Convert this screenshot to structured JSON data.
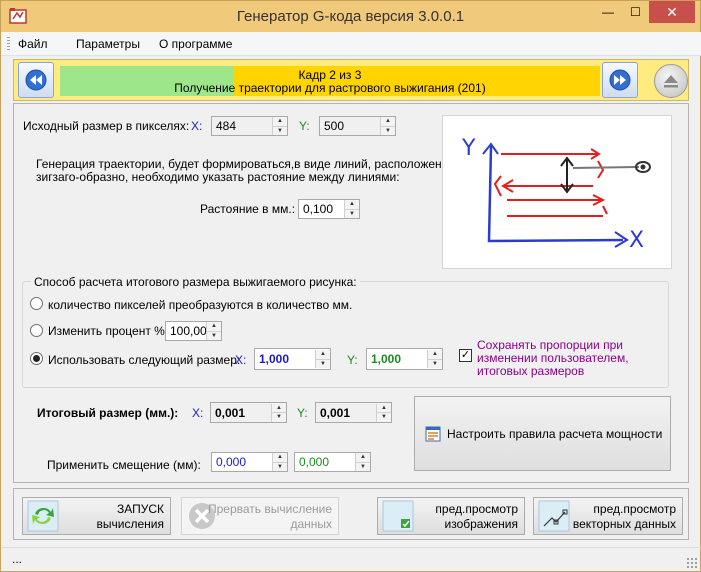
{
  "window": {
    "title": "Генератор G-кода версия 3.0.0.1",
    "min_symbol": "—",
    "max_symbol": "☐",
    "close_symbol": "✕"
  },
  "menu": {
    "items": [
      {
        "label": "Файл"
      },
      {
        "label": "Параметры"
      },
      {
        "label": "О программе"
      }
    ]
  },
  "wizard": {
    "step_text": "Кадр 2 из 3",
    "step_desc": "Получение траектории для растрового выжигания (201)",
    "progress_fraction": 0.32
  },
  "source_size": {
    "label": "Исходный размер в пикселях:",
    "x_label": "X:",
    "x_value": "484",
    "y_label": "Y:",
    "y_value": "500"
  },
  "description": {
    "line1": "Генерация траектории, будет формироваться,в виде линий, расположенных",
    "line2": "зигзаго-образно,  необходимо указать растояние между линиями:"
  },
  "distance": {
    "label": "Растояние в мм.:",
    "value": "0,100"
  },
  "preview": {
    "y_axis_label": "Y",
    "x_axis_label": "X"
  },
  "calc_group": {
    "title": "Способ расчета итогового размера выжигаемого рисунка:",
    "option_pixels": "количество пикселей преобразуются в количество мм.",
    "option_percent": "Изменить процент %",
    "percent_value": "100,00",
    "option_size": "Использовать следующий размер:",
    "x_label": "X:",
    "x_value": "1,000",
    "y_label": "Y:",
    "y_value": "1,000",
    "selected": "option_size",
    "keep_proportions_line1": "Сохранять пропорции при",
    "keep_proportions_line2": "изменении пользователем,",
    "keep_proportions_line3": "итоговых размеров",
    "keep_proportions_checked": true,
    "checkmark": "✓",
    "accent_color": "#8b008b"
  },
  "final_size": {
    "label": "Итоговый размер (мм.):",
    "x_label": "X:",
    "x_value": "0,001",
    "y_label": "Y:",
    "y_value": "0,001"
  },
  "offset": {
    "label": "Применить смещение (мм):",
    "x_value": "0,000",
    "y_value": "0,000"
  },
  "power_button": {
    "label": "Настроить правила расчета мощности"
  },
  "bottom_buttons": {
    "start_line1": "ЗАПУСК",
    "start_line2": "вычисления",
    "abort_line1": "Прервать вычисление",
    "abort_line2": "данных",
    "preview_image_line1": "пред.просмотр",
    "preview_image_line2": "изображения",
    "preview_vector_line1": "пред.просмотр",
    "preview_vector_line2": "векторных данных"
  },
  "status": {
    "text": "..."
  },
  "colors": {
    "title_bar": "#f0c97a",
    "wizard_bg": "#ffeb80",
    "progress_done": "#9de78a",
    "progress_rest": "#ffd400",
    "x_axis_color": "#1a1acc",
    "y_axis_color": "#1c8a1c"
  }
}
